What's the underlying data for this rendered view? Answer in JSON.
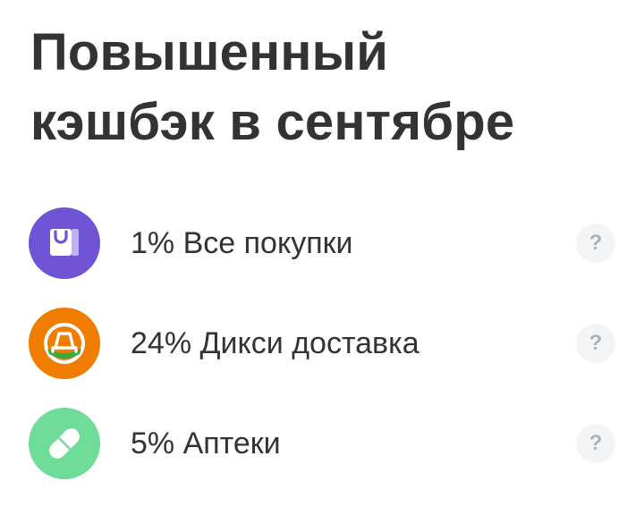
{
  "header": {
    "title_line1": "Повышенный",
    "title_line2": "кэшбэк в сентябре"
  },
  "cashback_items": [
    {
      "label": "1% Все покупки",
      "icon": "shopping-bag-icon",
      "icon_color": "#6f55d6"
    },
    {
      "label": "24% Дикси доставка",
      "icon": "dixy-logo-icon",
      "icon_color": "#f07d00"
    },
    {
      "label": "5% Аптеки",
      "icon": "pill-icon",
      "icon_color": "#6fdc9a"
    }
  ],
  "help_symbol": "?"
}
